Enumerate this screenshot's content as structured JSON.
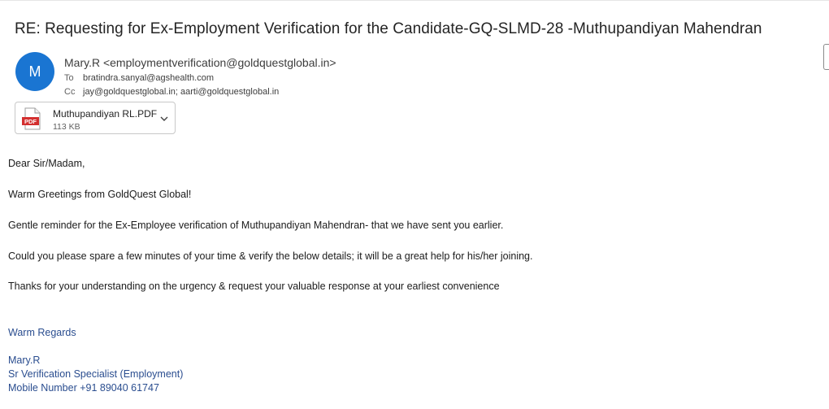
{
  "email": {
    "subject": "RE:  Requesting for Ex-Employment Verification for the Candidate-GQ-SLMD-28 -Muthupandiyan Mahendran",
    "avatar_initial": "M",
    "sender": "Mary.R <employmentverification@goldquestglobal.in>",
    "to_label": "To",
    "to": "bratindra.sanyal@agshealth.com",
    "cc_label": "Cc",
    "cc": "jay@goldquestglobal.in; aarti@goldquestglobal.in"
  },
  "attachment": {
    "name": "Muthupandiyan RL.PDF",
    "size": "113 KB",
    "icon_label": "PDF",
    "icon": "pdf-file-icon"
  },
  "body": {
    "greeting": "Dear Sir/Madam,",
    "line1": "Warm Greetings from GoldQuest Global!",
    "line2": "Gentle reminder for the Ex-Employee verification of Muthupandiyan Mahendran-  that we have sent you earlier.",
    "line3": "Could you please spare a few minutes of your time & verify the below details; it will be a great help for his/her joining.",
    "line4": "Thanks for your understanding on the urgency & request your valuable response at your earliest convenience"
  },
  "signature": {
    "regards": "Warm Regards",
    "name": "Mary.R",
    "title": "Sr Verification Specialist (Employment)",
    "mobile": "Mobile Number +91 89040 61747"
  },
  "colors": {
    "avatar_bg": "#1a75d2",
    "signature_text": "#2a4d8f",
    "pdf_red": "#d32f2f"
  }
}
